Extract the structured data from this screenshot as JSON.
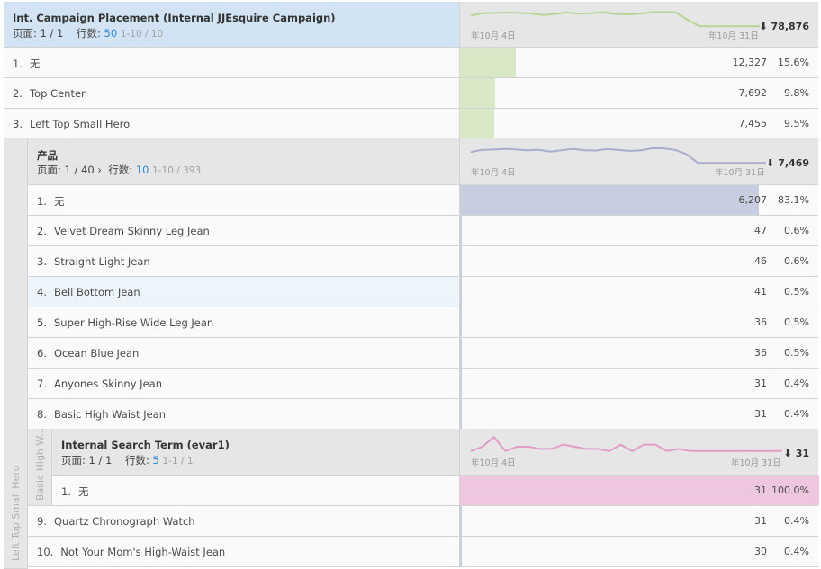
{
  "colors": {
    "green": "#d9e8c7",
    "green_line": "#b4d595",
    "purple": "#c9cde0",
    "purple_line": "#a8aecb",
    "pink": "#efc6df",
    "pink_line": "#e19fc8",
    "blue_link": "#2d8ad6"
  },
  "level1": {
    "title": "Int. Campaign Placement (Internal JJEsquire Campaign)",
    "page_label": "页面:",
    "page_value": "1 / 1",
    "rows_label": "行数:",
    "rows_value": "50",
    "range": "1-10 / 10",
    "date_start": "年10月 4日",
    "date_end": "年10月 31日",
    "total": "78,876",
    "trend": [
      0.7,
      0.8,
      0.82,
      0.84,
      0.82,
      0.79,
      0.72,
      0.77,
      0.84,
      0.78,
      0.8,
      0.85,
      0.77,
      0.75,
      0.78,
      0.85,
      0.86,
      0.85,
      0.5,
      0.2,
      0.2,
      0.2,
      0.2,
      0.2,
      0.2
    ],
    "rows": [
      {
        "num": "1.",
        "label": "无",
        "value": "12,327",
        "pct": "15.6%",
        "share": 0.156
      },
      {
        "num": "2.",
        "label": "Top Center",
        "value": "7,692",
        "pct": "9.8%",
        "share": 0.098
      },
      {
        "num": "3.",
        "label": "Left Top Small Hero",
        "value": "7,455",
        "pct": "9.5%",
        "share": 0.095
      }
    ]
  },
  "level2": {
    "gutter_label": "Left Top Small Hero",
    "title": "产品",
    "page_label": "页面:",
    "page_value": "1 / 40",
    "rows_label": "行数:",
    "rows_value": "10",
    "range": "1-10 / 393",
    "date_start": "年10月 4日",
    "date_end": "年10月 31日",
    "total": "7,469",
    "trend": [
      0.7,
      0.8,
      0.82,
      0.85,
      0.82,
      0.78,
      0.8,
      0.72,
      0.78,
      0.85,
      0.78,
      0.77,
      0.84,
      0.8,
      0.75,
      0.78,
      0.88,
      0.87,
      0.8,
      0.6,
      0.2,
      0.2,
      0.2,
      0.2,
      0.2,
      0.2,
      0.2
    ],
    "rows": [
      {
        "num": "1.",
        "label": "无",
        "value": "6,207",
        "pct": "83.1%",
        "share": 0.831
      },
      {
        "num": "2.",
        "label": "Velvet Dream Skinny Leg Jean",
        "value": "47",
        "pct": "0.6%",
        "share": 0.006
      },
      {
        "num": "3.",
        "label": "Straight Light Jean",
        "value": "46",
        "pct": "0.6%",
        "share": 0.006
      },
      {
        "num": "4.",
        "label": "Bell Bottom Jean",
        "value": "41",
        "pct": "0.5%",
        "share": 0.005
      },
      {
        "num": "5.",
        "label": "Super High-Rise Wide Leg Jean",
        "value": "36",
        "pct": "0.5%",
        "share": 0.005
      },
      {
        "num": "6.",
        "label": "Ocean Blue Jean",
        "value": "36",
        "pct": "0.5%",
        "share": 0.005
      },
      {
        "num": "7.",
        "label": "Anyones Skinny Jean",
        "value": "31",
        "pct": "0.4%",
        "share": 0.004
      },
      {
        "num": "8.",
        "label": "Basic High Waist Jean",
        "value": "31",
        "pct": "0.4%",
        "share": 0.004
      }
    ],
    "rows_after": [
      {
        "num": "9.",
        "label": "Quartz Chronograph Watch",
        "value": "31",
        "pct": "0.4%",
        "share": 0.004
      },
      {
        "num": "10.",
        "label": "Not Your Mom's High-Waist Jean",
        "value": "30",
        "pct": "0.4%",
        "share": 0.004
      }
    ]
  },
  "level3": {
    "gutter_label": "Basic High W...",
    "title": "Internal Search Term (evar1)",
    "page_label": "页面:",
    "page_value": "1 / 1",
    "rows_label": "行数:",
    "rows_value": "5",
    "range": "1-1 / 1",
    "date_start": "年10月 4日",
    "date_end": "年10月 31日",
    "total": "31",
    "trend": [
      0.3,
      0.5,
      0.95,
      0.3,
      0.5,
      0.5,
      0.4,
      0.4,
      0.6,
      0.5,
      0.4,
      0.4,
      0.3,
      0.6,
      0.3,
      0.6,
      0.6,
      0.3,
      0.4,
      0.3,
      0.3,
      0.3,
      0.3,
      0.3,
      0.3,
      0.3,
      0.3,
      0.3
    ],
    "rows": [
      {
        "num": "1.",
        "label": "无",
        "value": "31",
        "pct": "100.0%",
        "share": 1.0
      }
    ]
  }
}
